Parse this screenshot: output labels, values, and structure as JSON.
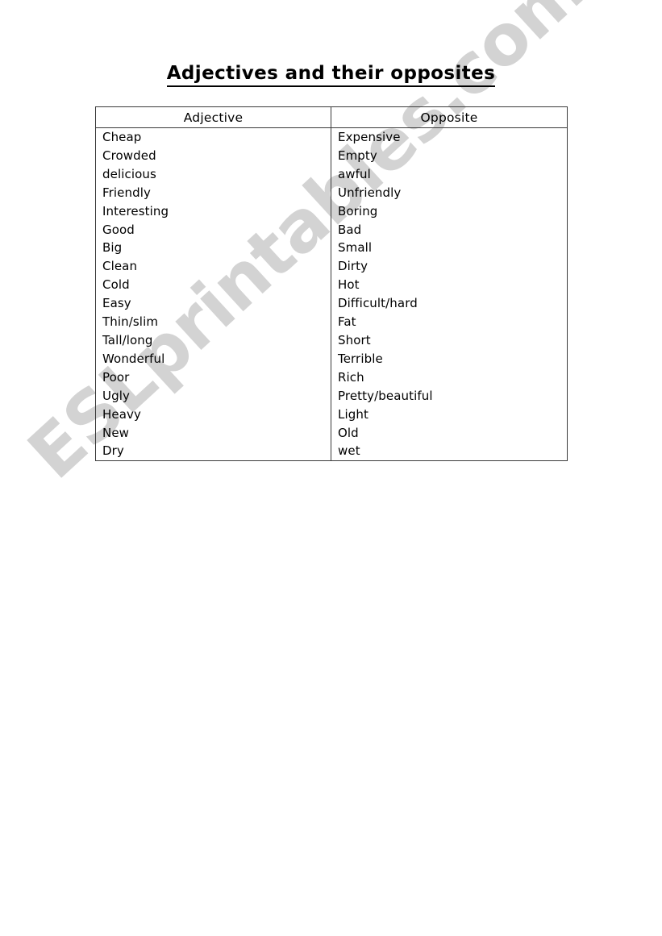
{
  "document": {
    "title": "Adjectives and their opposites",
    "background_color": "#ffffff",
    "text_color": "#000000"
  },
  "watermark": {
    "text": "ESLprintables.com",
    "color": "#d3d3d3"
  },
  "table": {
    "headers": {
      "adjective": "Adjective",
      "opposite": "Opposite"
    },
    "rows": [
      {
        "adjective": "Cheap",
        "opposite": "Expensive"
      },
      {
        "adjective": "Crowded",
        "opposite": "Empty"
      },
      {
        "adjective": "delicious",
        "opposite": "awful"
      },
      {
        "adjective": "Friendly",
        "opposite": "Unfriendly"
      },
      {
        "adjective": "Interesting",
        "opposite": "Boring"
      },
      {
        "adjective": "Good",
        "opposite": "Bad"
      },
      {
        "adjective": "Big",
        "opposite": "Small"
      },
      {
        "adjective": "Clean",
        "opposite": "Dirty"
      },
      {
        "adjective": "Cold",
        "opposite": "Hot"
      },
      {
        "adjective": "Easy",
        "opposite": "Difficult/hard"
      },
      {
        "adjective": "Thin/slim",
        "opposite": "Fat"
      },
      {
        "adjective": "Tall/long",
        "opposite": "Short"
      },
      {
        "adjective": "Wonderful",
        "opposite": "Terrible"
      },
      {
        "adjective": "Poor",
        "opposite": "Rich"
      },
      {
        "adjective": "Ugly",
        "opposite": "Pretty/beautiful"
      },
      {
        "adjective": "Heavy",
        "opposite": "Light"
      },
      {
        "adjective": "New",
        "opposite": "Old"
      },
      {
        "adjective": "Dry",
        "opposite": "wet"
      }
    ]
  }
}
